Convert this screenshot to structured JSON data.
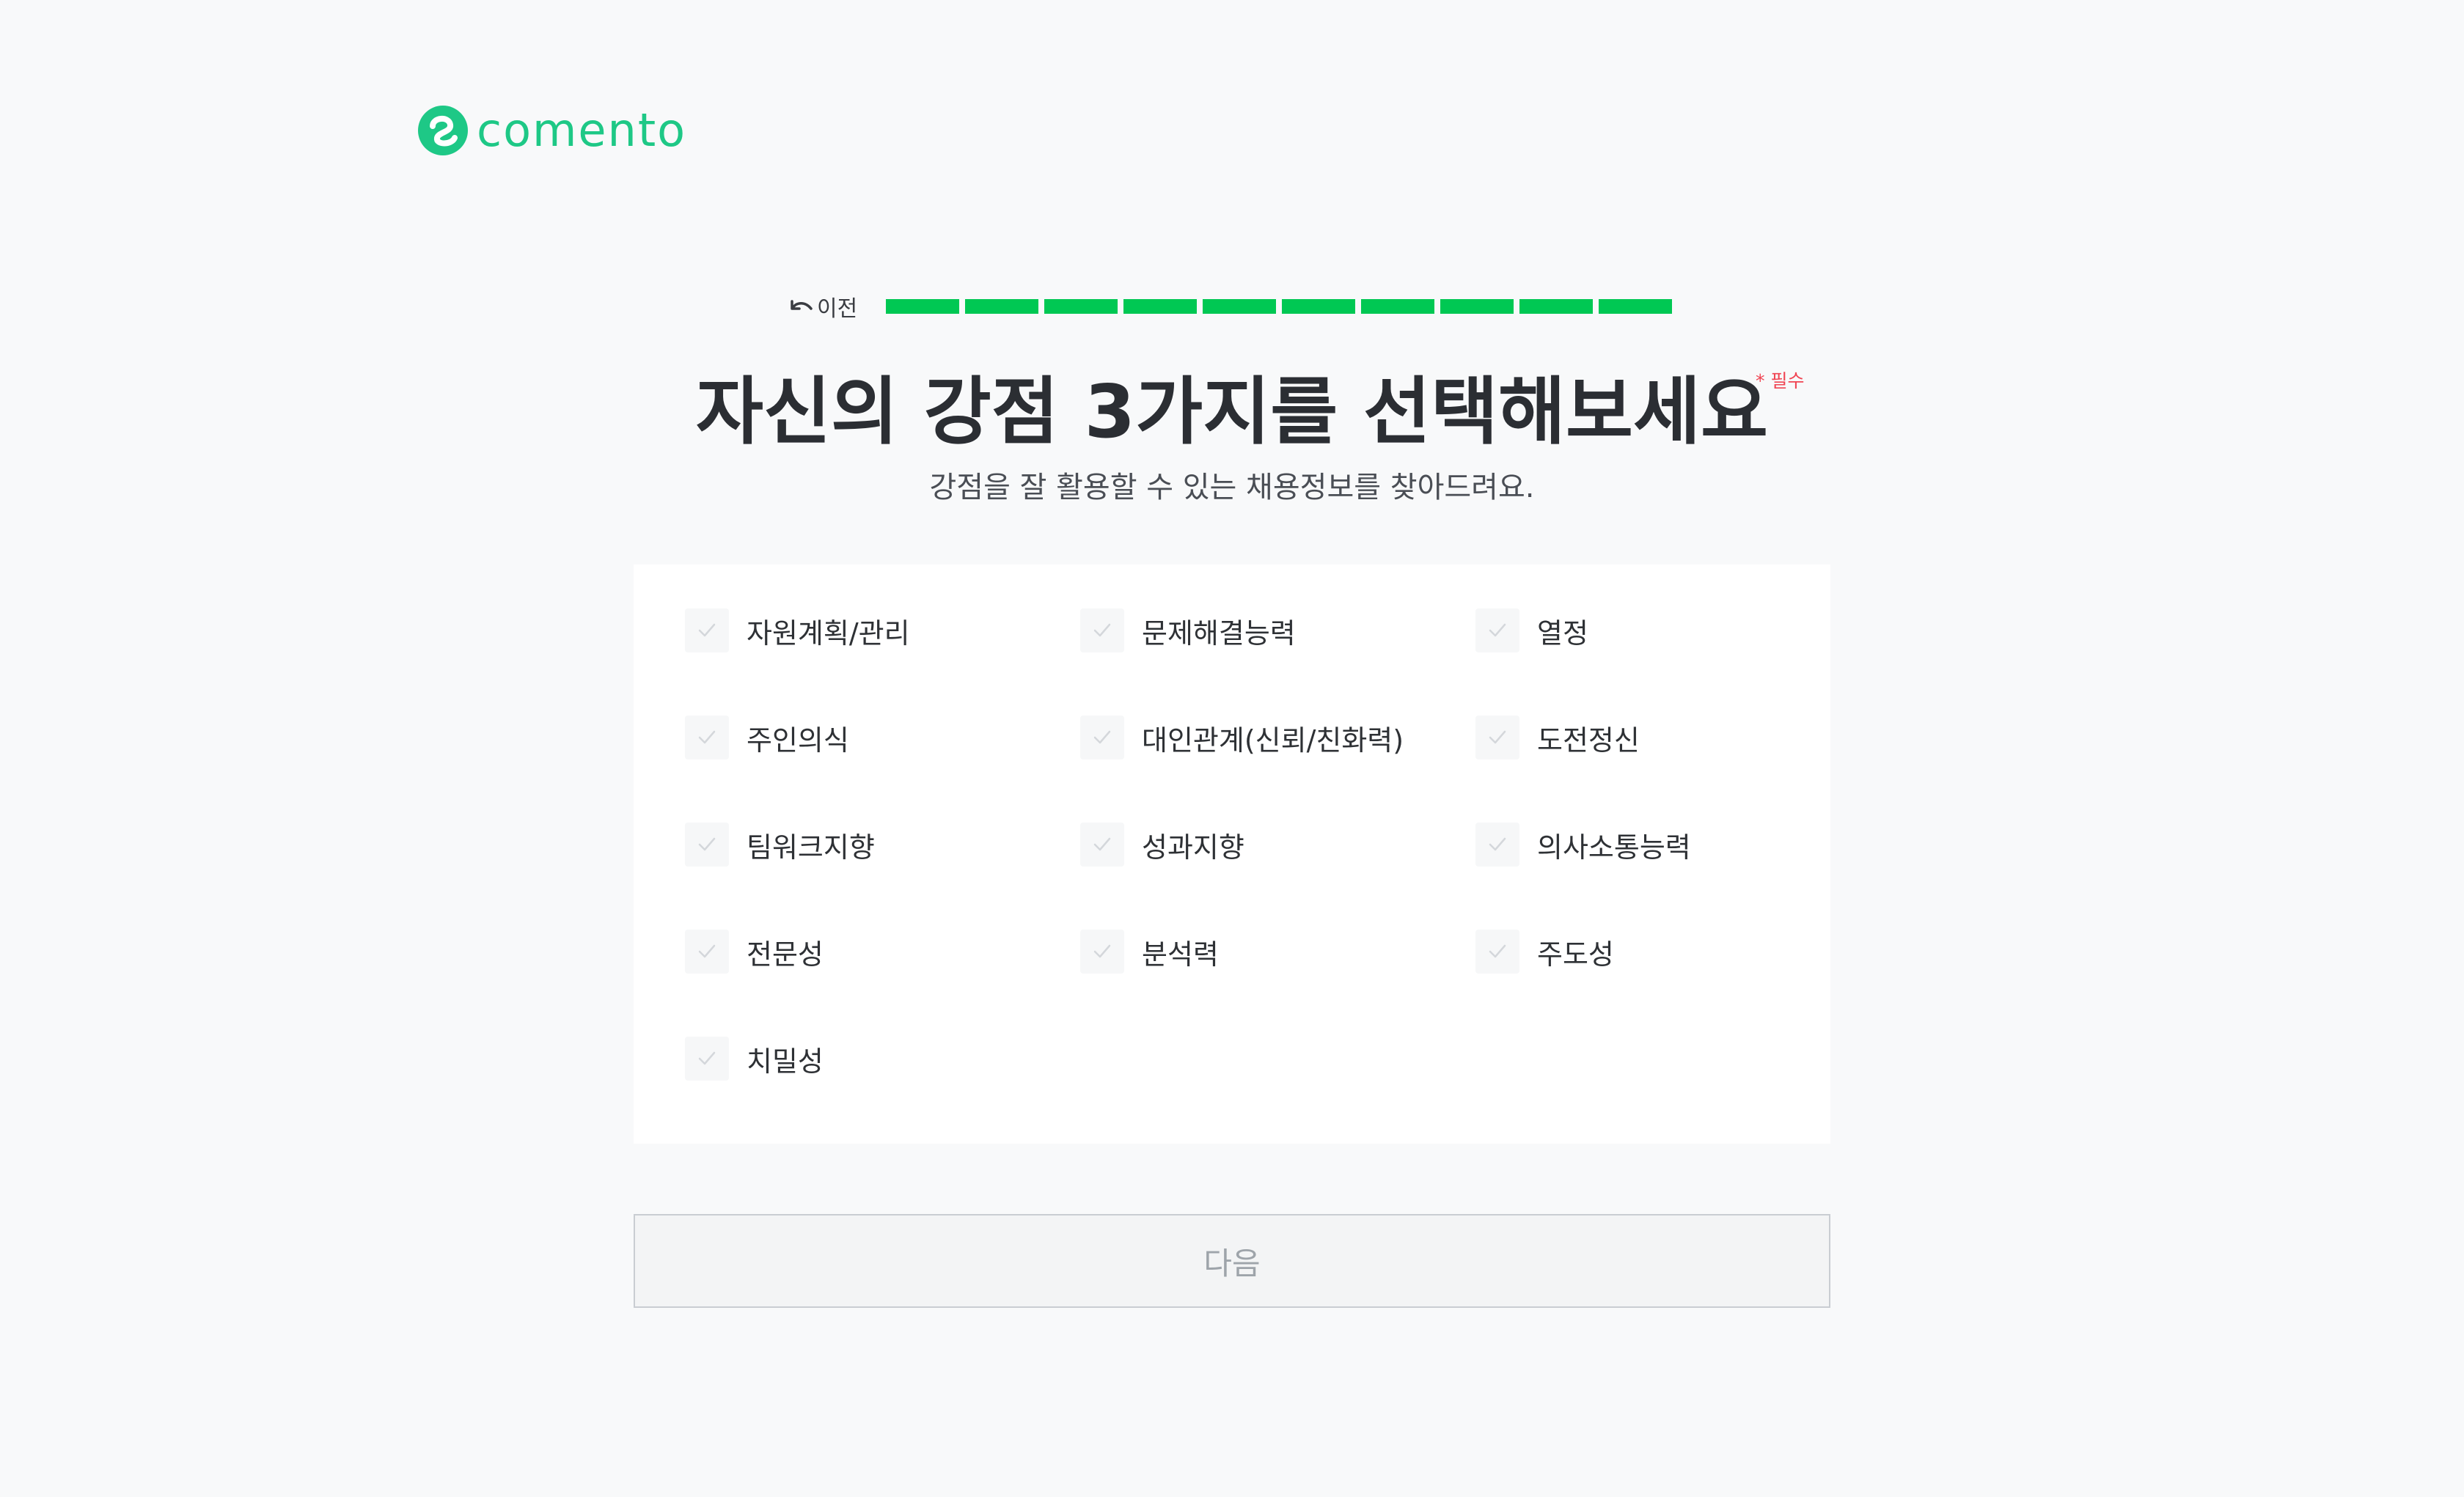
{
  "brand": {
    "name": "comento",
    "color": "#1ec886"
  },
  "progress": {
    "back_label": "이전",
    "steps_total": 10,
    "steps_completed": 10,
    "color": "#00c853"
  },
  "question": {
    "title": "자신의 강점 3가지를 선택해보세요",
    "required_label": "* 필수",
    "subtitle": "강점을 잘 활용할 수 있는 채용정보를 찾아드려요."
  },
  "options": [
    {
      "label": "자원계획/관리",
      "checked": false
    },
    {
      "label": "문제해결능력",
      "checked": false
    },
    {
      "label": "열정",
      "checked": false
    },
    {
      "label": "주인의식",
      "checked": false
    },
    {
      "label": "대인관계(신뢰/친화력)",
      "checked": false
    },
    {
      "label": "도전정신",
      "checked": false
    },
    {
      "label": "팀워크지향",
      "checked": false
    },
    {
      "label": "성과지향",
      "checked": false
    },
    {
      "label": "의사소통능력",
      "checked": false
    },
    {
      "label": "전문성",
      "checked": false
    },
    {
      "label": "분석력",
      "checked": false
    },
    {
      "label": "주도성",
      "checked": false
    },
    {
      "label": "치밀성",
      "checked": false
    }
  ],
  "next_button": {
    "label": "다음",
    "enabled": false
  }
}
